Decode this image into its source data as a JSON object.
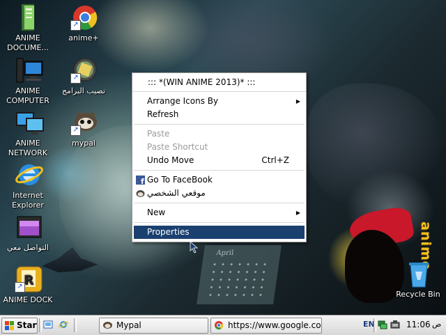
{
  "desktop": {
    "icons": [
      {
        "label": "ANIME DOCUME...",
        "icon": "folder-documents-icon"
      },
      {
        "label": "ANIME COMPUTER",
        "icon": "computer-icon"
      },
      {
        "label": "ANIME NETWORK",
        "icon": "network-icon"
      },
      {
        "label": "Internet Explorer",
        "icon": "internet-explorer-icon"
      },
      {
        "label": "التواصل معي",
        "icon": "contact-window-icon"
      },
      {
        "label": "ANIME DOCK",
        "icon": "dock-icon"
      },
      {
        "label": "anime+",
        "icon": "chrome-icon"
      },
      {
        "label": "تصيب البرامج",
        "icon": "installer-icon"
      },
      {
        "label": "mypal",
        "icon": "mypal-icon"
      },
      {
        "label": "Recycle Bin",
        "icon": "recycle-bin-icon"
      }
    ],
    "wallpaper": {
      "calendar_month": "April",
      "watermark": "anime"
    }
  },
  "context_menu": {
    "header": "::: *(WIN ANIME 2013)* :::",
    "items": [
      {
        "label": "Arrange Icons By",
        "submenu": true,
        "enabled": true
      },
      {
        "label": "Refresh",
        "enabled": true
      },
      {
        "label": "Paste",
        "enabled": false
      },
      {
        "label": "Paste Shortcut",
        "enabled": false
      },
      {
        "label": "Undo Move",
        "shortcut": "Ctrl+Z",
        "enabled": true
      },
      {
        "label": "Go To FaceBook",
        "icon": "facebook-icon",
        "enabled": true
      },
      {
        "label": "موقعي الشخصي",
        "icon": "personal-site-icon",
        "enabled": true
      },
      {
        "label": "New",
        "submenu": true,
        "enabled": true
      },
      {
        "label": "Properties",
        "highlighted": true,
        "enabled": true
      }
    ]
  },
  "taskbar": {
    "start_label": "Start",
    "quick_launch": [
      "show-desktop-icon",
      "internet-explorer-icon"
    ],
    "tasks": [
      {
        "label": "Mypal",
        "icon": "mypal-icon"
      },
      {
        "label": "https://www.google.co...",
        "icon": "chrome-icon"
      }
    ],
    "tray": {
      "language": "EN",
      "time": "11:06",
      "ampm": "ص"
    }
  },
  "colors": {
    "menu_highlight": "#1a4070",
    "taskbar_bg": "#e6e6e6"
  }
}
